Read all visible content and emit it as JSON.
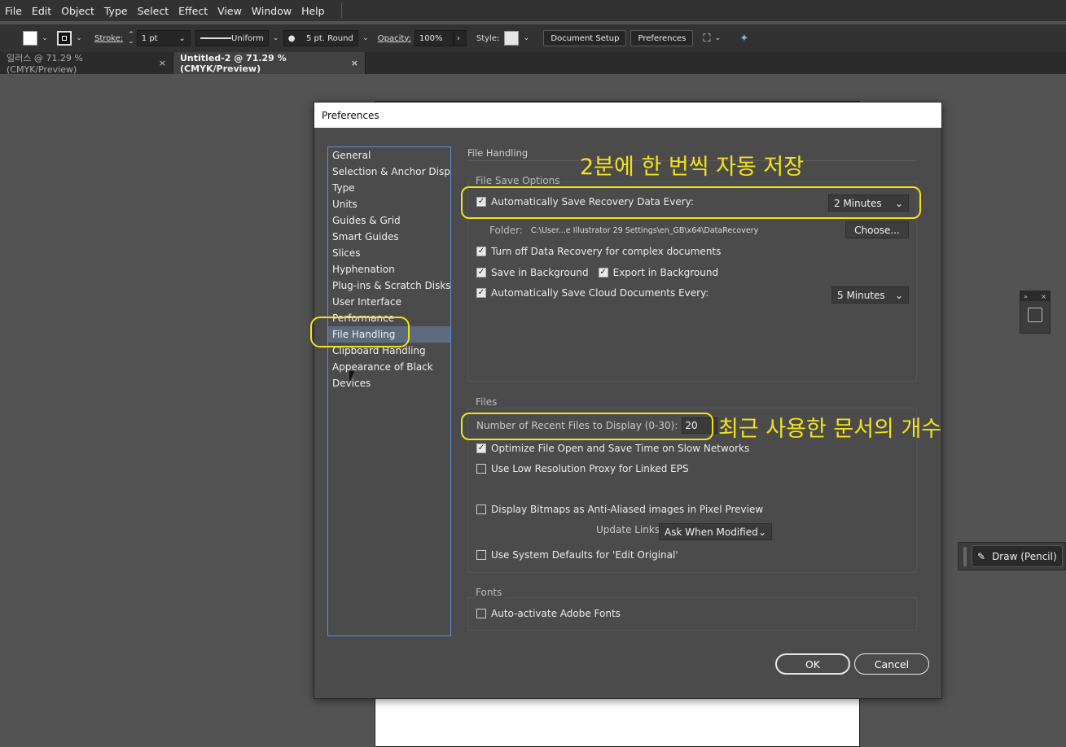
{
  "menu": [
    "File",
    "Edit",
    "Object",
    "Type",
    "Select",
    "Effect",
    "View",
    "Window",
    "Help"
  ],
  "control_bar": {
    "stroke_label": "Stroke:",
    "stroke_value": "1 pt",
    "profile": "Uniform",
    "brush": "5 pt. Round",
    "opacity_label": "Opacity:",
    "opacity_value": "100%",
    "style_label": "Style:",
    "document_setup": "Document Setup",
    "preferences": "Preferences"
  },
  "tabs": [
    {
      "label": "일러스 @ 71.29 % (CMYK/Preview)",
      "close": "×"
    },
    {
      "label": "Untitled-2 @ 71.29 % (CMYK/Preview)",
      "close": "×"
    }
  ],
  "pencil_panel": {
    "label": "Draw (Pencil)"
  },
  "dialog": {
    "title": "Preferences",
    "nav_items": [
      "General",
      "Selection & Anchor Display",
      "Type",
      "Units",
      "Guides & Grid",
      "Smart Guides",
      "Slices",
      "Hyphenation",
      "Plug-ins & Scratch Disks",
      "User Interface",
      "Performance",
      "File Handling",
      "Clipboard Handling",
      "Appearance of Black",
      "Devices"
    ],
    "selected_nav": "File Handling",
    "section_title": "File Handling",
    "file_save_options": {
      "title": "File Save Options",
      "auto_save_label": "Automatically Save Recovery Data Every:",
      "auto_save_checked": true,
      "auto_save_interval": "2 Minutes",
      "folder_label": "Folder:",
      "folder_path": "C:\\User...e Illustrator 29 Settings\\en_GB\\x64\\DataRecovery",
      "choose_button": "Choose...",
      "turn_off_label": "Turn off Data Recovery for complex documents",
      "save_background_label": "Save in Background",
      "export_background_label": "Export in Background",
      "cloud_label": "Automatically Save Cloud Documents Every:",
      "cloud_interval": "5 Minutes"
    },
    "files": {
      "title": "Files",
      "recent_label": "Number of Recent Files to Display (0-30):",
      "recent_value": "20",
      "optimize_label": "Optimize File Open and Save Time on Slow Networks",
      "low_res_label": "Use Low Resolution Proxy for Linked EPS",
      "bitmaps_label": "Display Bitmaps as Anti-Aliased images in Pixel Preview",
      "update_links_label": "Update Links:",
      "update_links_value": "Ask When Modified",
      "system_defaults_label": "Use System Defaults for 'Edit Original'"
    },
    "fonts": {
      "title": "Fonts",
      "auto_activate_label": "Auto-activate Adobe Fonts"
    },
    "ok": "OK",
    "cancel": "Cancel"
  },
  "annotations": {
    "auto_save_note": "2분에 한 번씩 자동 저장",
    "recent_files_note": "최근 사용한 문서의 개수",
    "highlight_color": "#f2e21a"
  }
}
